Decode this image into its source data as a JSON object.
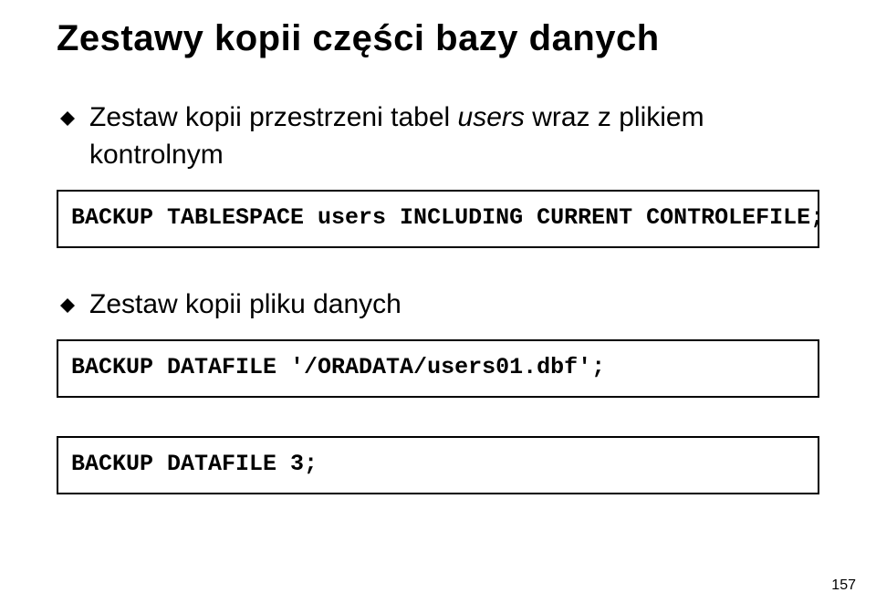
{
  "title": "Zestawy kopii części bazy danych",
  "bullets": [
    {
      "text_prefix": "Zestaw kopii przestrzeni tabel ",
      "text_italic": "users",
      "text_suffix": " wraz z plikiem kontrolnym"
    },
    {
      "text_prefix": "Zestaw kopii pliku danych",
      "text_italic": "",
      "text_suffix": ""
    }
  ],
  "code_blocks": [
    {
      "lines": [
        "BACKUP TABLESPACE users INCLUDING CURRENT CONTROLEFILE;"
      ]
    },
    {
      "lines": [
        "BACKUP DATAFILE '/ORADATA/users01.dbf';"
      ]
    },
    {
      "lines": [
        "BACKUP DATAFILE 3;"
      ]
    }
  ],
  "page_number": "157"
}
